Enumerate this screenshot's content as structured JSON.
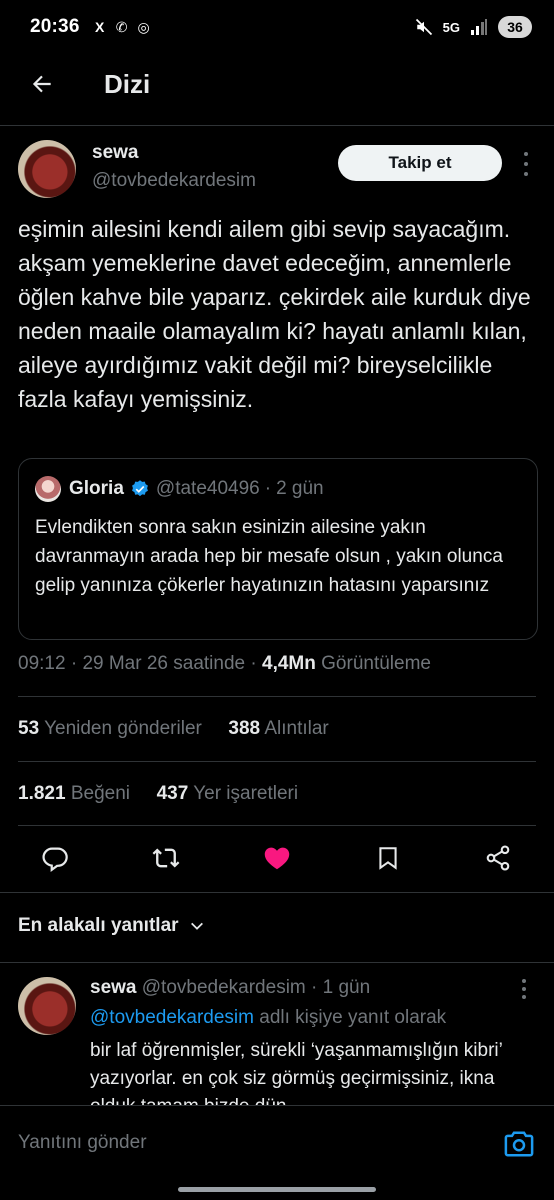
{
  "status_bar": {
    "time": "20:36",
    "apps": [
      "X",
      "✆",
      "◎"
    ],
    "network": "5G",
    "battery": "36"
  },
  "header": {
    "title": "Dizi"
  },
  "tweet": {
    "author_name": "sewa",
    "author_handle": "@tovbedekardesim",
    "follow_label": "Takip et",
    "text": "eşimin ailesini kendi ailem gibi sevip sayacağım. akşam yemeklerine davet edeceğim, annemlerle öğlen kahve bile yaparız. çekirdek aile kurduk diye neden maaile olamayalım ki? hayatı anlamlı kılan, aileye ayırdığımız vakit değil mi? bireyselcilikle fazla kafayı yemişsiniz.",
    "quote": {
      "name": "Gloria",
      "handle": "@tate40496",
      "time": "2 gün",
      "text": "Evlendikten sonra sakın esinizin ailesine yakın davranmayın arada hep bir mesafe olsun , yakın olunca gelip yanınıza çökerler hayatınızın hatasını yaparsınız"
    },
    "meta": {
      "time": "09:12",
      "date": "29 Mar 26 saatinde",
      "views": "4,4Mn",
      "views_label": "Görüntüleme"
    },
    "stats": {
      "reposts": "53",
      "reposts_label": "Yeniden gönderiler",
      "quotes": "388",
      "quotes_label": "Alıntılar",
      "likes": "1.821",
      "likes_label": "Beğeni",
      "bookmarks": "437",
      "bookmarks_label": "Yer işaretleri"
    }
  },
  "replies_sort": "En alakalı yanıtlar",
  "reply": {
    "name": "sewa",
    "handle": "@tovbedekardesim",
    "time": "1 gün",
    "mention": "@tovbedekardesim",
    "reply_to_suffix": "adlı kişiye yanıt olarak",
    "text": "bir laf öğrenmişler, sürekli ‘yaşanmamışlığın kibri’ yazıyorlar. en çok siz görmüş geçirmişsiniz, ikna olduk tamam bizde dün"
  },
  "compose": {
    "placeholder": "Yanıtını gönder"
  },
  "colors": {
    "accent": "#1d9bf0",
    "like": "#f91880",
    "muted": "#71767b",
    "divider": "#2f3336"
  }
}
